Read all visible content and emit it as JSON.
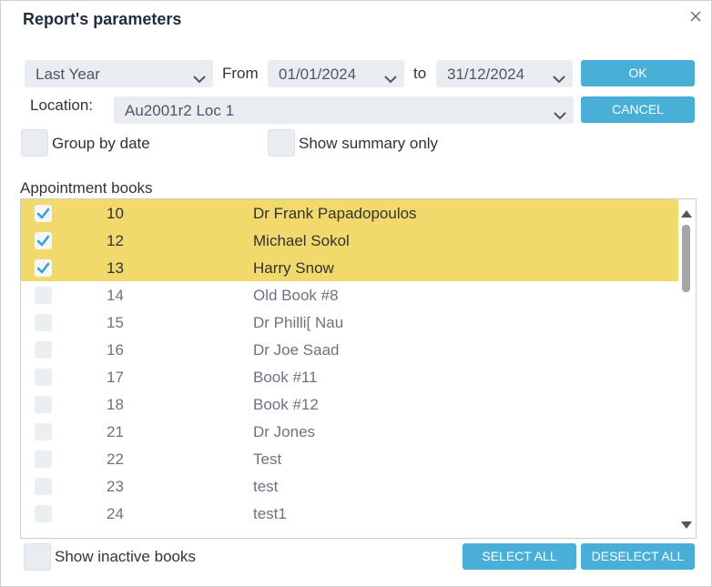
{
  "dialog": {
    "title": "Report's parameters"
  },
  "period": {
    "selected": "Last Year",
    "from_label": "From",
    "from_date": "01/01/2024",
    "to_label": "to",
    "to_date": "31/12/2024"
  },
  "location": {
    "label": "Location:",
    "selected": "Au2001r2 Loc 1"
  },
  "buttons": {
    "ok": "OK",
    "cancel": "CANCEL",
    "select_all": "SELECT ALL",
    "deselect_all": "DESELECT ALL"
  },
  "options": {
    "group_by_date": "Group by date",
    "show_summary_only": "Show summary only",
    "show_inactive_books": "Show inactive books"
  },
  "books": {
    "label": "Appointment books",
    "rows": [
      {
        "num": "10",
        "name": "Dr Frank Papadopoulos",
        "checked": true
      },
      {
        "num": "12",
        "name": "Michael Sokol",
        "checked": true
      },
      {
        "num": "13",
        "name": "Harry Snow",
        "checked": true
      },
      {
        "num": "14",
        "name": "Old Book #8",
        "checked": false
      },
      {
        "num": "15",
        "name": "Dr Philli[ Nau",
        "checked": false
      },
      {
        "num": "16",
        "name": "Dr Joe Saad",
        "checked": false
      },
      {
        "num": "17",
        "name": "Book #11",
        "checked": false
      },
      {
        "num": "18",
        "name": "Book #12",
        "checked": false
      },
      {
        "num": "21",
        "name": "Dr Jones",
        "checked": false
      },
      {
        "num": "22",
        "name": "Test",
        "checked": false
      },
      {
        "num": "23",
        "name": "test",
        "checked": false
      },
      {
        "num": "24",
        "name": "test1",
        "checked": false
      }
    ]
  },
  "colors": {
    "accent": "#4aafd7",
    "selected_row": "#f2d96b",
    "check": "#3a9fd6"
  }
}
